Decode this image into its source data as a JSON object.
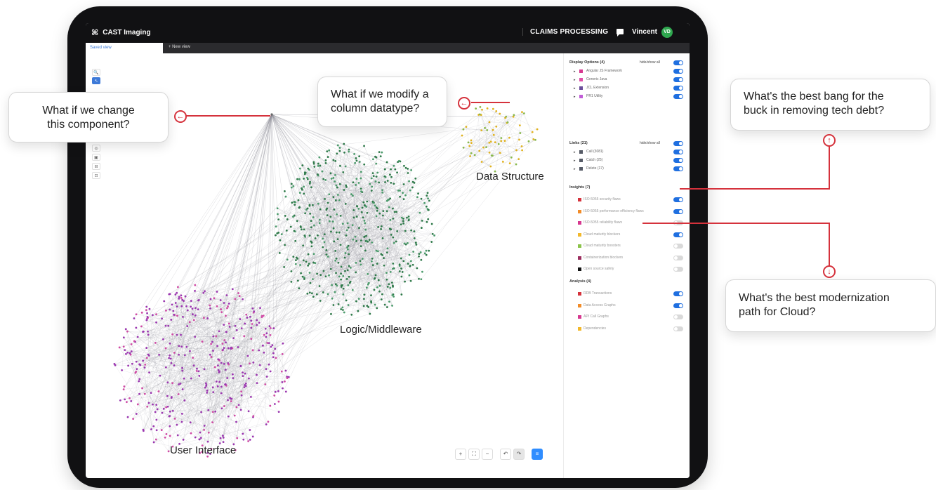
{
  "app": {
    "brand_icon": "⌘",
    "title": "CAST Imaging",
    "project": "CLAIMS PROCESSING",
    "user_name": "Vincent",
    "user_initials": "VD"
  },
  "tabs": {
    "active": "Saved view",
    "new": "+ New view"
  },
  "tools": [
    "🔍",
    "↖",
    "☐",
    "◎",
    "▣",
    "⊟",
    "⊡"
  ],
  "zoom_controls": [
    "+",
    "⛶",
    "−",
    "↶",
    "↷",
    "≡"
  ],
  "panel": {
    "display_options": {
      "title": "Display Options (4)",
      "toggle_label": "hide/show all",
      "items": [
        {
          "label": "Angular JS Framework",
          "color": "#d6378f",
          "on": true
        },
        {
          "label": "Generic Java",
          "color": "#e04fa8",
          "on": true
        },
        {
          "label": "JCL Extension",
          "color": "#6b4e9b",
          "on": true
        },
        {
          "label": "PR1 Utility",
          "color": "#c05bd6",
          "on": true
        }
      ]
    },
    "links": {
      "title": "Links (21)",
      "toggle_label": "hide/show all",
      "items": [
        {
          "label": "Call (3081)",
          "color": "#555a66",
          "on": true
        },
        {
          "label": "Catch (25)",
          "color": "#555a66",
          "on": true
        },
        {
          "label": "Delete (17)",
          "color": "#555a66",
          "on": true
        }
      ]
    },
    "insights": {
      "title": "Insights (7)",
      "items": [
        {
          "label": "ISO-5055 security flaws",
          "color": "#d5323c",
          "on": true
        },
        {
          "label": "ISO-5055 performance efficiency flaws",
          "color": "#f28c28",
          "on": true
        },
        {
          "label": "ISO-5055 reliability flaws",
          "color": "#d6378f",
          "on": false
        },
        {
          "label": "Cloud maturity blockers",
          "color": "#f2b82b",
          "on": true
        },
        {
          "label": "Cloud maturity boosters",
          "color": "#8bc34a",
          "on": false
        },
        {
          "label": "Containerization blockers",
          "color": "#9b2d5e",
          "on": false
        },
        {
          "label": "Open source safety",
          "color": "#111111",
          "on": false
        }
      ]
    },
    "analysis": {
      "title": "Analysis (4)",
      "items": [
        {
          "label": "RDB Transactions",
          "color": "#d5323c",
          "on": true
        },
        {
          "label": "Data Access Graphs",
          "color": "#f28c28",
          "on": true
        },
        {
          "label": "API Call Graphs",
          "color": "#d6378f",
          "on": false
        },
        {
          "label": "Dependencies",
          "color": "#f2b82b",
          "on": false
        }
      ]
    }
  },
  "clusters": {
    "data_structure": "Data Structure",
    "logic": "Logic/Middleware",
    "ui": "User Interface"
  },
  "callouts": {
    "component": "What if we  change\nthis component?",
    "column": "What if we modify a\ncolumn datatype?",
    "tech_debt": "What's the best bang for the\nbuck in removing tech debt?",
    "cloud": "What's the best modernization\npath for Cloud?"
  },
  "colors": {
    "accent_red": "#d5323c",
    "toggle_blue": "#1f6fe0",
    "ui_node": "#9b37b0",
    "logic_node": "#2f7a4a",
    "data_node": "#e0b21f"
  }
}
